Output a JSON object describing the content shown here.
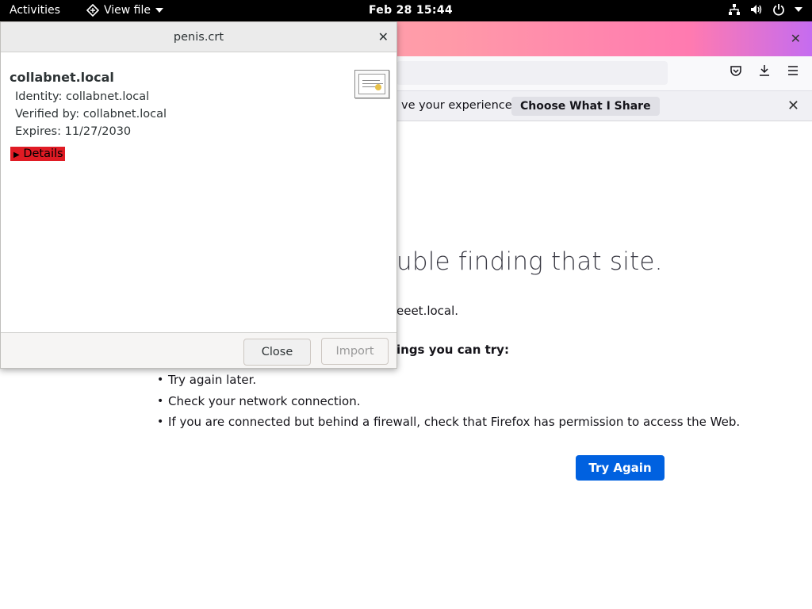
{
  "topbar": {
    "activities": "Activities",
    "app_name": "View file",
    "clock": "Feb 28  15:44"
  },
  "firefox": {
    "notification": {
      "text": "ve your experience.",
      "button": "Choose What I Share"
    },
    "error": {
      "title": "uble finding that site.",
      "subtitle": "eeet.local.",
      "try_heading": "ings you can try:",
      "list": [
        "Try again later.",
        "Check your network connection.",
        "If you are connected but behind a firewall, check that Firefox has permission to access the Web."
      ],
      "try_again_button": "Try Again"
    }
  },
  "dialog": {
    "title": "penis.crt",
    "cert_name": "collabnet.local",
    "identity": "Identity: collabnet.local",
    "verified_by": "Verified by: collabnet.local",
    "expires": "Expires: 11/27/2030",
    "details_label": "Details",
    "close_button": "Close",
    "import_button": "Import"
  },
  "colors": {
    "details_highlight": "#e01b24",
    "try_again_bg": "#0061e0"
  }
}
